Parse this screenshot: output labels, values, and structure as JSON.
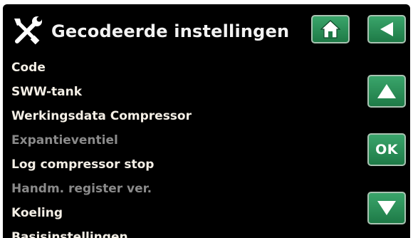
{
  "header": {
    "title": "Gecodeerde instellingen",
    "icon": "tools-icon"
  },
  "buttons": {
    "home_icon": "home-icon",
    "back_icon": "back-arrow-icon",
    "up_icon": "up-arrow-icon",
    "down_icon": "down-arrow-icon",
    "ok_label": "OK"
  },
  "menu": {
    "items": [
      {
        "label": "Code",
        "enabled": true
      },
      {
        "label": "SWW-tank",
        "enabled": true
      },
      {
        "label": "Werkingsdata Compressor",
        "enabled": true
      },
      {
        "label": "Expantieventiel",
        "enabled": false
      },
      {
        "label": "Log compressor stop",
        "enabled": true
      },
      {
        "label": "Handm. register ver.",
        "enabled": false
      },
      {
        "label": "Koeling",
        "enabled": true
      },
      {
        "label": "Basisinstellingen",
        "enabled": true
      }
    ]
  },
  "colors": {
    "background": "#000000",
    "button": "#2a8f58",
    "text": "#f4efe6",
    "disabled_text": "#8a8a8a"
  }
}
